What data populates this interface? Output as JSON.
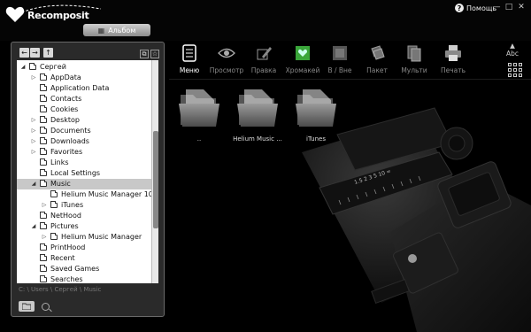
{
  "app": {
    "name": "Recomposit"
  },
  "window": {
    "help_label": "Помощь",
    "minimize": "—",
    "maximize": "□",
    "close": "✕"
  },
  "album_tab": {
    "label": "Альбом"
  },
  "tree": {
    "items": [
      {
        "label": "Сергей",
        "indent": 1,
        "expand": "open"
      },
      {
        "label": "AppData",
        "indent": 2,
        "expand": "closed"
      },
      {
        "label": "Application Data",
        "indent": 2,
        "expand": "none"
      },
      {
        "label": "Contacts",
        "indent": 2,
        "expand": "none"
      },
      {
        "label": "Cookies",
        "indent": 2,
        "expand": "none"
      },
      {
        "label": "Desktop",
        "indent": 2,
        "expand": "closed"
      },
      {
        "label": "Documents",
        "indent": 2,
        "expand": "closed"
      },
      {
        "label": "Downloads",
        "indent": 2,
        "expand": "closed"
      },
      {
        "label": "Favorites",
        "indent": 2,
        "expand": "closed"
      },
      {
        "label": "Links",
        "indent": 2,
        "expand": "none"
      },
      {
        "label": "Local Settings",
        "indent": 2,
        "expand": "none"
      },
      {
        "label": "Music",
        "indent": 2,
        "expand": "open",
        "selected": true
      },
      {
        "label": "Helium Music Manager 10",
        "indent": 3,
        "expand": "none"
      },
      {
        "label": "iTunes",
        "indent": 3,
        "expand": "closed"
      },
      {
        "label": "NetHood",
        "indent": 2,
        "expand": "none"
      },
      {
        "label": "Pictures",
        "indent": 2,
        "expand": "open"
      },
      {
        "label": "Helium Music Manager",
        "indent": 3,
        "expand": "closed"
      },
      {
        "label": "PrintHood",
        "indent": 2,
        "expand": "none"
      },
      {
        "label": "Recent",
        "indent": 2,
        "expand": "none"
      },
      {
        "label": "Saved Games",
        "indent": 2,
        "expand": "none"
      },
      {
        "label": "Searches",
        "indent": 2,
        "expand": "none"
      }
    ]
  },
  "path": "C: \\ Users \\ Сергей \\ Music",
  "toolbar": {
    "items": [
      {
        "label": "Меню",
        "icon": "menu-icon",
        "active": true
      },
      {
        "label": "Просмотр",
        "icon": "eye-icon"
      },
      {
        "label": "Правка",
        "icon": "edit-icon"
      },
      {
        "label": "Хромакей",
        "icon": "chromakey-icon"
      },
      {
        "label": "В / Вне",
        "icon": "in-out-icon"
      },
      {
        "label": "Пакет",
        "icon": "batch-icon"
      },
      {
        "label": "Мульти",
        "icon": "multi-icon"
      },
      {
        "label": "Печать",
        "icon": "print-icon"
      }
    ],
    "sort_label": "Abc"
  },
  "folders": [
    {
      "label": ".."
    },
    {
      "label": "Helium Music ..."
    },
    {
      "label": "iTunes"
    }
  ],
  "colors": {
    "accent_green": "#3aa63a",
    "bg": "#000000"
  }
}
